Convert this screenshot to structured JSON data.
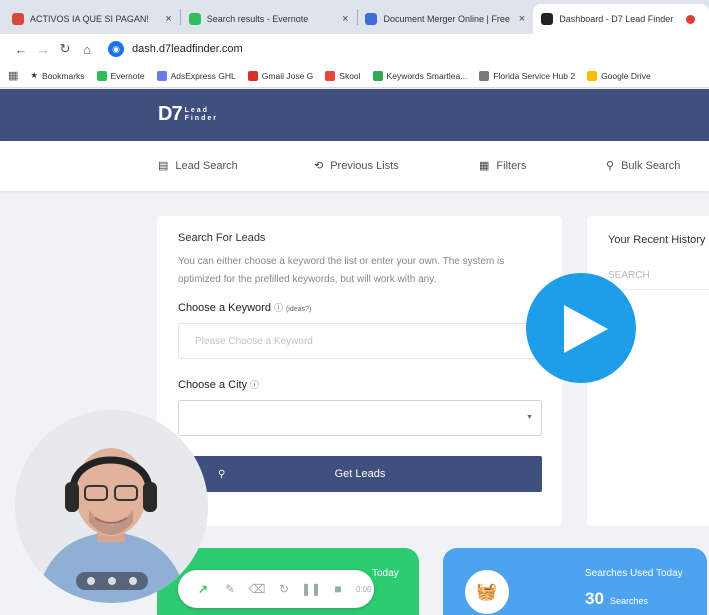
{
  "browser": {
    "tabs": [
      {
        "title": "ACTIVOS IA QUE SI PAGAN!",
        "close": "×",
        "color": "#d44a3a"
      },
      {
        "title": "Search results - Evernote",
        "close": "×",
        "color": "#2dbe60"
      },
      {
        "title": "Document Merger Online | Free",
        "close": "×",
        "color": "#3a6fd8"
      },
      {
        "title": "Dashboard - D7 Lead Finder",
        "close": "",
        "color": "#222222"
      }
    ],
    "url": "dash.d7leadfinder.com",
    "bookmarks": [
      {
        "label": "Bookmarks",
        "color": "#555555"
      },
      {
        "label": "Evernote",
        "color": "#2dbe60"
      },
      {
        "label": "AdsExpress GHL",
        "color": "#6b7be8"
      },
      {
        "label": "Gmail Jose G",
        "color": "#d93025"
      },
      {
        "label": "Skool",
        "color": "#e8453c"
      },
      {
        "label": "Keywords Smartlea...",
        "color": "#34a853"
      },
      {
        "label": "Florida Service Hub 2",
        "color": "#7a7a7a"
      },
      {
        "label": "Google Drive",
        "color": "#fbbc04"
      }
    ]
  },
  "site": {
    "logo": {
      "mark": "D7",
      "line1": "Lead",
      "line2": "Finder"
    },
    "nav": {
      "lead_search": "Lead Search",
      "previous_lists": "Previous Lists",
      "filters": "Filters",
      "bulk_search": "Bulk Search"
    }
  },
  "search_card": {
    "title": "Search For Leads",
    "description": "You can either choose a keyword the list or enter your own. The system is optimized for the prefilled keywords, but will work with any.",
    "keyword_label": "Choose a Keyword",
    "keyword_help": "(ideas?)",
    "keyword_placeholder": "Please Choose a Keyword",
    "city_label": "Choose a City",
    "button": "Get Leads"
  },
  "history": {
    "title": "Your Recent History",
    "search_placeholder": "SEARCH"
  },
  "stats": {
    "leads_label": "Today",
    "searches_label": "Searches Used Today",
    "searches_value": "30",
    "searches_unit": "Searches"
  },
  "recorder": {
    "timer": "0:00"
  }
}
